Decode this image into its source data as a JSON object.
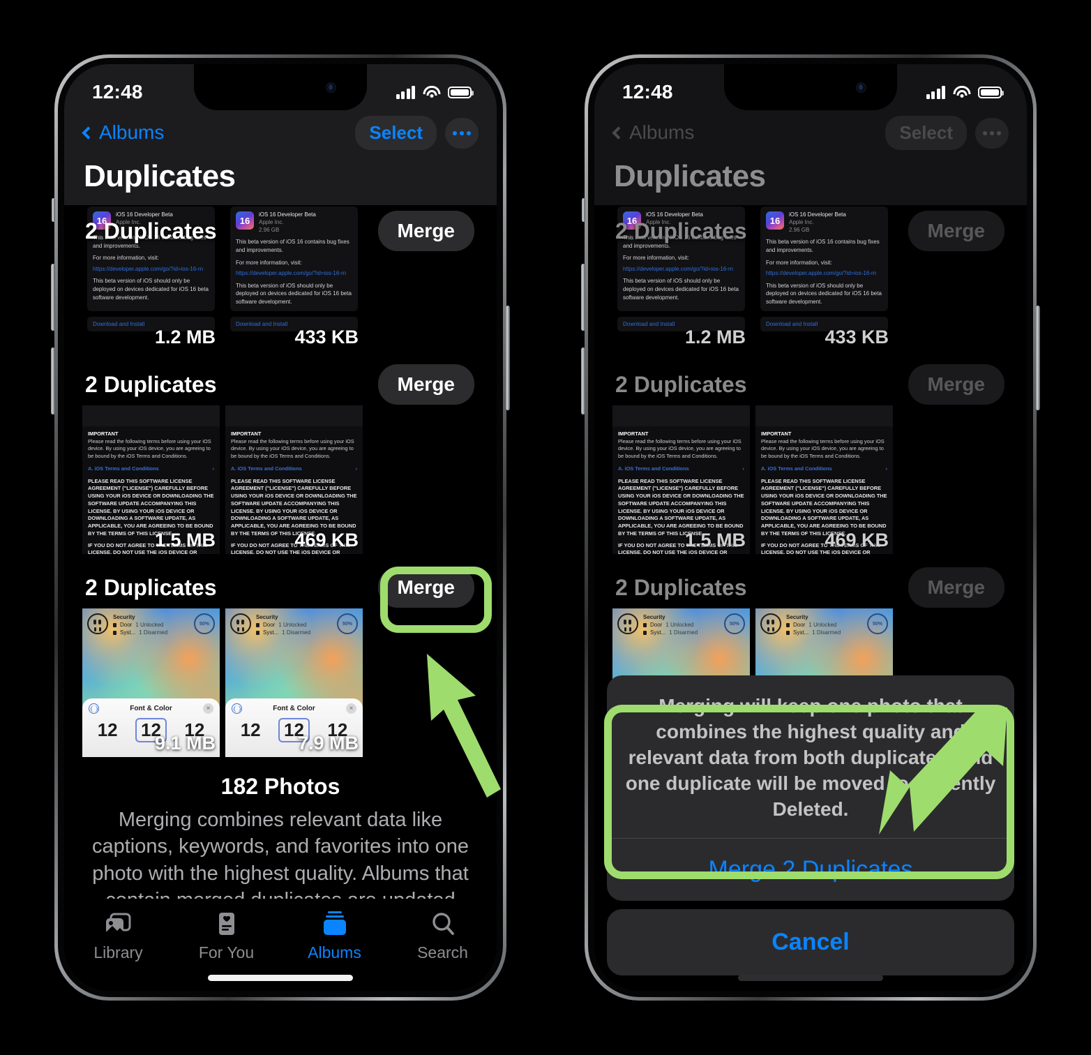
{
  "colors": {
    "accent": "#0a84ff",
    "highlight": "#9fdc6e",
    "panel": "#2c2c2e",
    "screen_bg": "#000000"
  },
  "status_bar": {
    "time": "12:48",
    "signal_icon": "cellular-bars-icon",
    "wifi_icon": "wifi-icon",
    "battery_icon": "battery-icon"
  },
  "nav": {
    "back_label": "Albums",
    "select_label": "Select",
    "more_label": "…",
    "title": "Duplicates"
  },
  "groups": [
    {
      "title": "2 Duplicates",
      "merge_label": "Merge",
      "photos": [
        {
          "size": "1.2 MB",
          "kind": "beta-notes",
          "app_title": "iOS 16 Developer Beta",
          "app_vendor": "Apple Inc.",
          "app_size": "",
          "body_1": "This beta version of iOS 16 contains bug fixes and improvements.",
          "body_2": "For more information, visit:",
          "link": "https://developer.apple.com/go/?id=ios-16-rn",
          "body_3": "This beta version of iOS should only be deployed on devices dedicated for iOS 16 beta software development.",
          "footer_link": "Download and Install"
        },
        {
          "size": "433 KB",
          "kind": "beta-notes",
          "app_title": "iOS 16 Developer Beta",
          "app_vendor": "Apple Inc.",
          "app_size": "2.96 GB",
          "body_1": "This beta version of iOS 16 contains bug fixes and improvements.",
          "body_2": "For more information, visit:",
          "link": "https://developer.apple.com/go/?id=ios-16-rn",
          "body_3": "This beta version of iOS should only be deployed on devices dedicated for iOS 16 beta software development.",
          "footer_link": "Download and Install"
        }
      ]
    },
    {
      "title": "2 Duplicates",
      "merge_label": "Merge",
      "photos": [
        {
          "size": "1.5 MB",
          "kind": "license",
          "hd": "IMPORTANT",
          "intro": "Please read the following terms before using your iOS device. By using your iOS device, you are agreeing to be bound by the iOS Terms and Conditions.",
          "link": "A. iOS Terms and Conditions",
          "para_1": "PLEASE READ THIS SOFTWARE LICENSE AGREEMENT (\"LICENSE\") CAREFULLY BEFORE USING YOUR iOS DEVICE OR DOWNLOADING THE SOFTWARE UPDATE ACCOMPANYING THIS LICENSE. BY USING YOUR iOS DEVICE OR DOWNLOADING A SOFTWARE UPDATE, AS APPLICABLE, YOU ARE AGREEING TO BE BOUND BY THE TERMS OF THIS LICENSE.",
          "para_2": "IF YOU DO NOT AGREE TO THE TERMS OF THIS LICENSE, DO NOT USE THE iOS DEVICE OR DOWNLOAD THIS SOFTWARE UPDATE. IF YOU HAVE RECENTLY PURCHASED AN iOS DEVICE AND YOU DO NOT AGREE"
        },
        {
          "size": "469 KB",
          "kind": "license",
          "hd": "IMPORTANT",
          "intro": "Please read the following terms before using your iOS device. By using your iOS device, you are agreeing to be bound by the iOS Terms and Conditions.",
          "link": "A. iOS Terms and Conditions",
          "para_1": "PLEASE READ THIS SOFTWARE LICENSE AGREEMENT (\"LICENSE\") CAREFULLY BEFORE USING YOUR iOS DEVICE OR DOWNLOADING THE SOFTWARE UPDATE ACCOMPANYING THIS LICENSE. BY USING YOUR iOS DEVICE OR DOWNLOADING A SOFTWARE UPDATE, AS APPLICABLE, YOU ARE AGREEING TO BE BOUND BY THE TERMS OF THIS LICENSE.",
          "para_2": "IF YOU DO NOT AGREE TO THE TERMS OF THIS LICENSE, DO NOT USE THE iOS DEVICE OR DOWNLOAD THIS SOFTWARE UPDATE. IF YOU HAVE RECENTLY PURCHASED AN iOS DEVICE AND YOU DO NOT AGREE"
        }
      ]
    },
    {
      "title": "2 Duplicates",
      "merge_label": "Merge",
      "photos": [
        {
          "size": "9.1 MB",
          "kind": "lockscreen",
          "widget_title": "Security",
          "row_1_label": "Door",
          "row_1_value": "1 Unlocked",
          "row_2_label": "Syst...",
          "row_2_value": "1 Disarmed",
          "ring_value": "50%",
          "sheet_title": "Font & Color",
          "clock_left": "12",
          "clock_mid": "12",
          "clock_right": "12"
        },
        {
          "size": "7.9 MB",
          "kind": "lockscreen",
          "widget_title": "Security",
          "row_1_label": "Door",
          "row_1_value": "1 Unlocked",
          "row_2_label": "Syst...",
          "row_2_value": "1 Disarmed",
          "ring_value": "50%",
          "sheet_title": "Font & Color",
          "clock_left": "12",
          "clock_mid": "12",
          "clock_right": "12"
        }
      ]
    }
  ],
  "footer": {
    "count": "182 Photos",
    "description": "Merging combines relevant data like captions, keywords, and favorites into one photo with the highest quality. Albums that contain merged duplicates are updated with the merged photo."
  },
  "tabbar": [
    {
      "label": "Library",
      "icon": "photos-library-icon",
      "active": false
    },
    {
      "label": "For You",
      "icon": "for-you-icon",
      "active": false
    },
    {
      "label": "Albums",
      "icon": "albums-icon",
      "active": true
    },
    {
      "label": "Search",
      "icon": "search-icon",
      "active": true
    }
  ],
  "action_sheet": {
    "message": "Merging will keep one photo that combines the highest quality and relevant data from both duplicates, and one duplicate will be moved to Recently Deleted.",
    "confirm_label": "Merge 2 Duplicates",
    "cancel_label": "Cancel"
  },
  "annotations": {
    "left_box_target": "merge-button-group-3",
    "left_arrow": "arrow-pointing-up-left",
    "right_box_target": "action-sheet-card",
    "right_arrow": "arrow-pointing-down-left"
  }
}
